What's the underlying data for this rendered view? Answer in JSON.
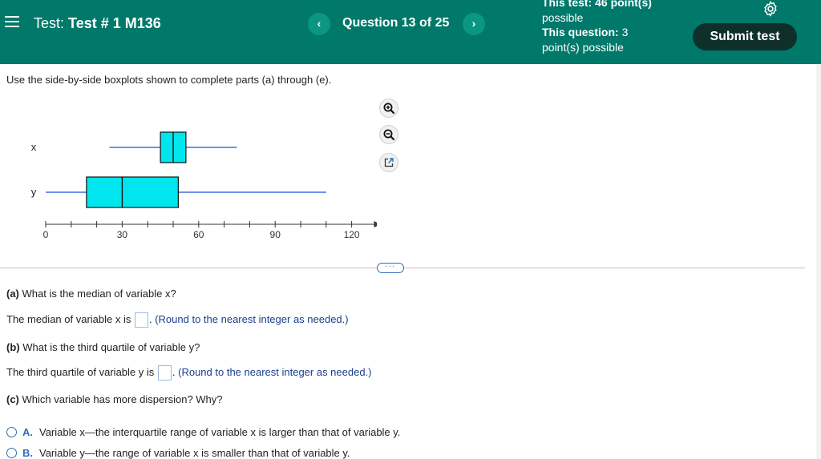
{
  "header": {
    "test_prefix": "Test:",
    "test_name": "Test # 1 M136",
    "prev_label": "‹",
    "next_label": "›",
    "question_label": "Question 13 of 25",
    "points_line1": "This test: 46 point(s)",
    "points_line2": "possible",
    "points_line3_bold": "This question:",
    "points_line3_rest": "3",
    "points_line4": "point(s) possible",
    "submit_label": "Submit test"
  },
  "instruction": "Use the side-by-side boxplots shown to complete parts (a) through (e).",
  "chart_data": {
    "type": "boxplot",
    "orientation": "horizontal",
    "series": [
      {
        "name": "x",
        "min": 25,
        "q1": 45,
        "median": 50,
        "q3": 55,
        "max": 75
      },
      {
        "name": "y",
        "min": 0,
        "q1": 16,
        "median": 30,
        "q3": 52,
        "max": 110
      }
    ],
    "xlim": [
      0,
      125
    ],
    "xticks": [
      0,
      30,
      60,
      90,
      120
    ],
    "minor_step": 10,
    "box_color": "#00e5ee",
    "whisker_color": "#1a4fd6"
  },
  "more_label": "···",
  "questions": {
    "a_label": "(a)",
    "a_text": "What is the median of variable x?",
    "a_answer_prefix": "The median of variable x is",
    "a_hint": "(Round to the nearest integer as needed.)",
    "b_label": "(b)",
    "b_text": "What is the third quartile of variable y?",
    "b_answer_prefix": "The third quartile of variable y is",
    "b_hint": "(Round to the nearest integer as needed.)",
    "c_label": "(c)",
    "c_text": "Which variable has more dispersion? Why?"
  },
  "options": [
    {
      "letter": "A.",
      "text": "Variable x—the interquartile range of variable x is larger than that of variable y."
    },
    {
      "letter": "B.",
      "text": "Variable y—the range of variable x is smaller than that of variable y."
    }
  ]
}
